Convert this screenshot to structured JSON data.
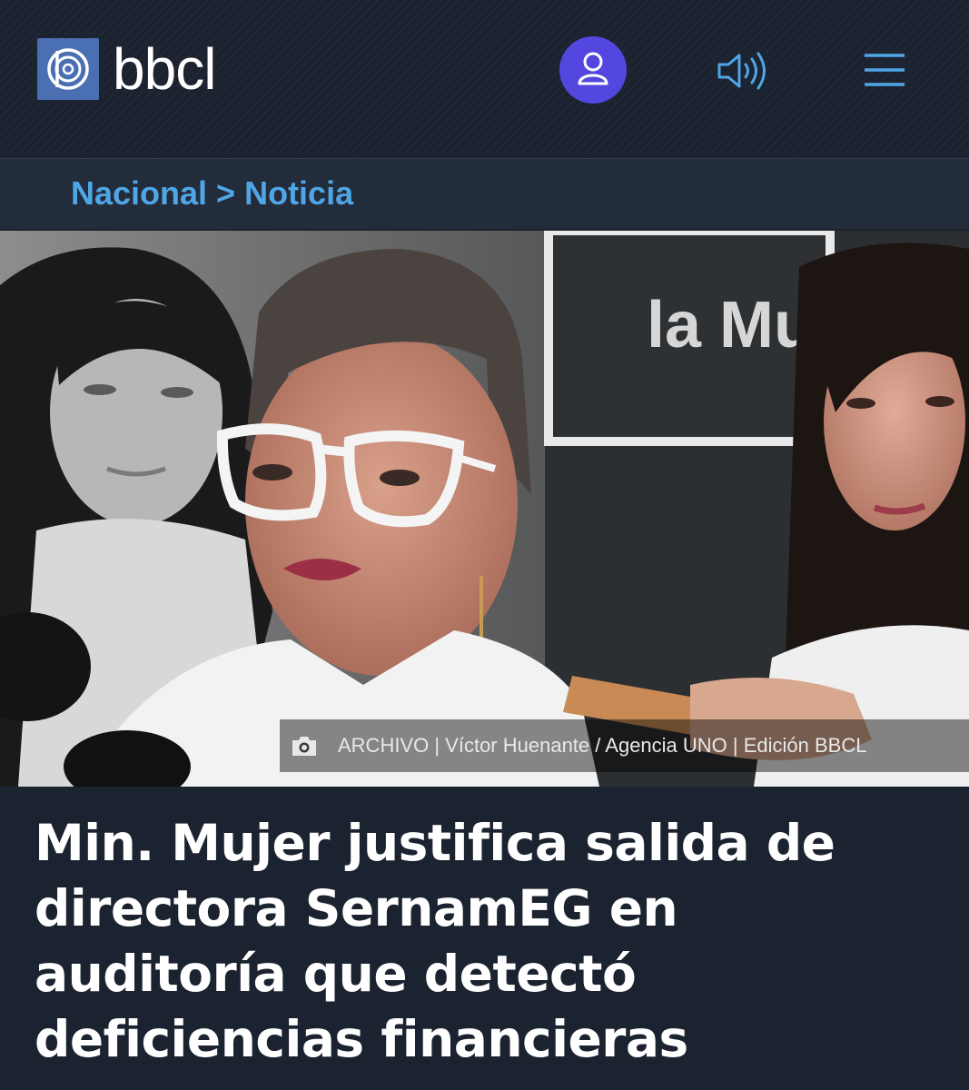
{
  "header": {
    "logo_text": "bbcl",
    "logo_icon": "bbcl-logo-icon",
    "user_icon": "user-icon",
    "audio_icon": "audio-speaker-icon",
    "menu_icon": "hamburger-menu-icon"
  },
  "breadcrumb": {
    "section": "Nacional",
    "separator": ">",
    "page": "Noticia"
  },
  "hero": {
    "background_sign_text": "la Mu",
    "caption_icon": "camera-icon",
    "caption": "ARCHIVO | Víctor Huenante / Agencia UNO | Edición BBCL"
  },
  "article": {
    "headline": "Min. Mujer justifica salida de directora SernamEG en auditoría que detectó deficiencias financieras"
  },
  "colors": {
    "header_bg": "#1b2230",
    "breadcrumb_link": "#4fa6e6",
    "user_button": "#5447e0",
    "icon_blue": "#4fa6e6",
    "logo_box": "#4a6fb3",
    "headline_text": "#ffffff"
  }
}
